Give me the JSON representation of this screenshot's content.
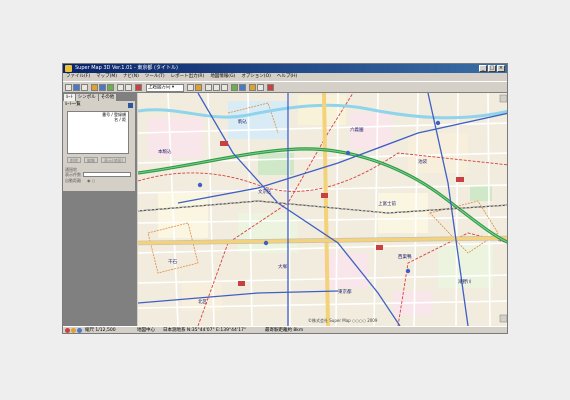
{
  "window": {
    "title": "Super Map 3D Ver.1.01 - 東京都 (タイトル)",
    "controls": [
      "_",
      "□",
      "×"
    ]
  },
  "menu": [
    "ファイル(F)",
    "マップ(M)",
    "ナビ(N)",
    "ツール(T)",
    "レポート出力(R)",
    "地図情報(G)",
    "オプション(O)",
    "ヘルプ(H)"
  ],
  "toolbar": {
    "scale_select": "上越図方向 ▾"
  },
  "panel": {
    "tabs": [
      "ﾙｰﾄ",
      "シンボル",
      "その他"
    ],
    "heading": "ﾙｰﾄ一覧",
    "list_header_1": "番号 / 登録順",
    "list_header_2": "名 / 距",
    "buttons": [
      "削除",
      "編集",
      "表示(地図)"
    ],
    "field_labels": [
      "通過地",
      "表示件数",
      "自動距離"
    ]
  },
  "status": {
    "scale": "縮尺 1/12,500",
    "center": "地図中心",
    "coords": "日本測地系 N:35°44'07\" E:139°44'17\"",
    "info": "最寄駅距離約 8km"
  },
  "map": {
    "copyright": "©株式会社 Super Map ○○○○ 2009",
    "labels": [
      "駒込",
      "六義園",
      "本駒込",
      "文京区",
      "上富士前",
      "千石",
      "大塚",
      "池袋",
      "西巣鴨",
      "東京都",
      "滝野川",
      "北区"
    ],
    "colors": {
      "river": "#8fd4ec",
      "green_road": "#2e9b46",
      "route_blue": "#3f5fc4",
      "boundary": "#d64040",
      "town_line": "#e08b3a"
    }
  }
}
